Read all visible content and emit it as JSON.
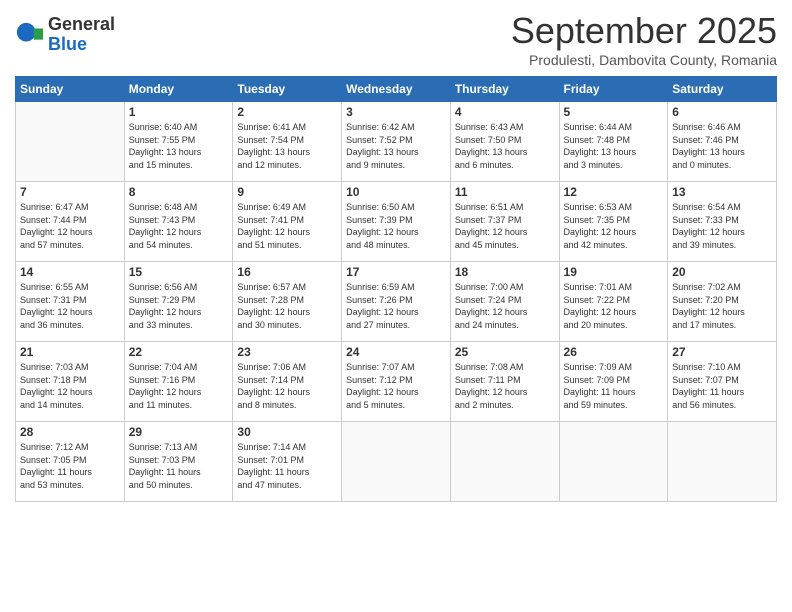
{
  "header": {
    "logo_general": "General",
    "logo_blue": "Blue",
    "month": "September 2025",
    "location": "Produlesti, Dambovita County, Romania"
  },
  "days_of_week": [
    "Sunday",
    "Monday",
    "Tuesday",
    "Wednesday",
    "Thursday",
    "Friday",
    "Saturday"
  ],
  "weeks": [
    [
      {
        "day": "",
        "content": ""
      },
      {
        "day": "1",
        "content": "Sunrise: 6:40 AM\nSunset: 7:55 PM\nDaylight: 13 hours\nand 15 minutes."
      },
      {
        "day": "2",
        "content": "Sunrise: 6:41 AM\nSunset: 7:54 PM\nDaylight: 13 hours\nand 12 minutes."
      },
      {
        "day": "3",
        "content": "Sunrise: 6:42 AM\nSunset: 7:52 PM\nDaylight: 13 hours\nand 9 minutes."
      },
      {
        "day": "4",
        "content": "Sunrise: 6:43 AM\nSunset: 7:50 PM\nDaylight: 13 hours\nand 6 minutes."
      },
      {
        "day": "5",
        "content": "Sunrise: 6:44 AM\nSunset: 7:48 PM\nDaylight: 13 hours\nand 3 minutes."
      },
      {
        "day": "6",
        "content": "Sunrise: 6:46 AM\nSunset: 7:46 PM\nDaylight: 13 hours\nand 0 minutes."
      }
    ],
    [
      {
        "day": "7",
        "content": "Sunrise: 6:47 AM\nSunset: 7:44 PM\nDaylight: 12 hours\nand 57 minutes."
      },
      {
        "day": "8",
        "content": "Sunrise: 6:48 AM\nSunset: 7:43 PM\nDaylight: 12 hours\nand 54 minutes."
      },
      {
        "day": "9",
        "content": "Sunrise: 6:49 AM\nSunset: 7:41 PM\nDaylight: 12 hours\nand 51 minutes."
      },
      {
        "day": "10",
        "content": "Sunrise: 6:50 AM\nSunset: 7:39 PM\nDaylight: 12 hours\nand 48 minutes."
      },
      {
        "day": "11",
        "content": "Sunrise: 6:51 AM\nSunset: 7:37 PM\nDaylight: 12 hours\nand 45 minutes."
      },
      {
        "day": "12",
        "content": "Sunrise: 6:53 AM\nSunset: 7:35 PM\nDaylight: 12 hours\nand 42 minutes."
      },
      {
        "day": "13",
        "content": "Sunrise: 6:54 AM\nSunset: 7:33 PM\nDaylight: 12 hours\nand 39 minutes."
      }
    ],
    [
      {
        "day": "14",
        "content": "Sunrise: 6:55 AM\nSunset: 7:31 PM\nDaylight: 12 hours\nand 36 minutes."
      },
      {
        "day": "15",
        "content": "Sunrise: 6:56 AM\nSunset: 7:29 PM\nDaylight: 12 hours\nand 33 minutes."
      },
      {
        "day": "16",
        "content": "Sunrise: 6:57 AM\nSunset: 7:28 PM\nDaylight: 12 hours\nand 30 minutes."
      },
      {
        "day": "17",
        "content": "Sunrise: 6:59 AM\nSunset: 7:26 PM\nDaylight: 12 hours\nand 27 minutes."
      },
      {
        "day": "18",
        "content": "Sunrise: 7:00 AM\nSunset: 7:24 PM\nDaylight: 12 hours\nand 24 minutes."
      },
      {
        "day": "19",
        "content": "Sunrise: 7:01 AM\nSunset: 7:22 PM\nDaylight: 12 hours\nand 20 minutes."
      },
      {
        "day": "20",
        "content": "Sunrise: 7:02 AM\nSunset: 7:20 PM\nDaylight: 12 hours\nand 17 minutes."
      }
    ],
    [
      {
        "day": "21",
        "content": "Sunrise: 7:03 AM\nSunset: 7:18 PM\nDaylight: 12 hours\nand 14 minutes."
      },
      {
        "day": "22",
        "content": "Sunrise: 7:04 AM\nSunset: 7:16 PM\nDaylight: 12 hours\nand 11 minutes."
      },
      {
        "day": "23",
        "content": "Sunrise: 7:06 AM\nSunset: 7:14 PM\nDaylight: 12 hours\nand 8 minutes."
      },
      {
        "day": "24",
        "content": "Sunrise: 7:07 AM\nSunset: 7:12 PM\nDaylight: 12 hours\nand 5 minutes."
      },
      {
        "day": "25",
        "content": "Sunrise: 7:08 AM\nSunset: 7:11 PM\nDaylight: 12 hours\nand 2 minutes."
      },
      {
        "day": "26",
        "content": "Sunrise: 7:09 AM\nSunset: 7:09 PM\nDaylight: 11 hours\nand 59 minutes."
      },
      {
        "day": "27",
        "content": "Sunrise: 7:10 AM\nSunset: 7:07 PM\nDaylight: 11 hours\nand 56 minutes."
      }
    ],
    [
      {
        "day": "28",
        "content": "Sunrise: 7:12 AM\nSunset: 7:05 PM\nDaylight: 11 hours\nand 53 minutes."
      },
      {
        "day": "29",
        "content": "Sunrise: 7:13 AM\nSunset: 7:03 PM\nDaylight: 11 hours\nand 50 minutes."
      },
      {
        "day": "30",
        "content": "Sunrise: 7:14 AM\nSunset: 7:01 PM\nDaylight: 11 hours\nand 47 minutes."
      },
      {
        "day": "",
        "content": ""
      },
      {
        "day": "",
        "content": ""
      },
      {
        "day": "",
        "content": ""
      },
      {
        "day": "",
        "content": ""
      }
    ]
  ]
}
